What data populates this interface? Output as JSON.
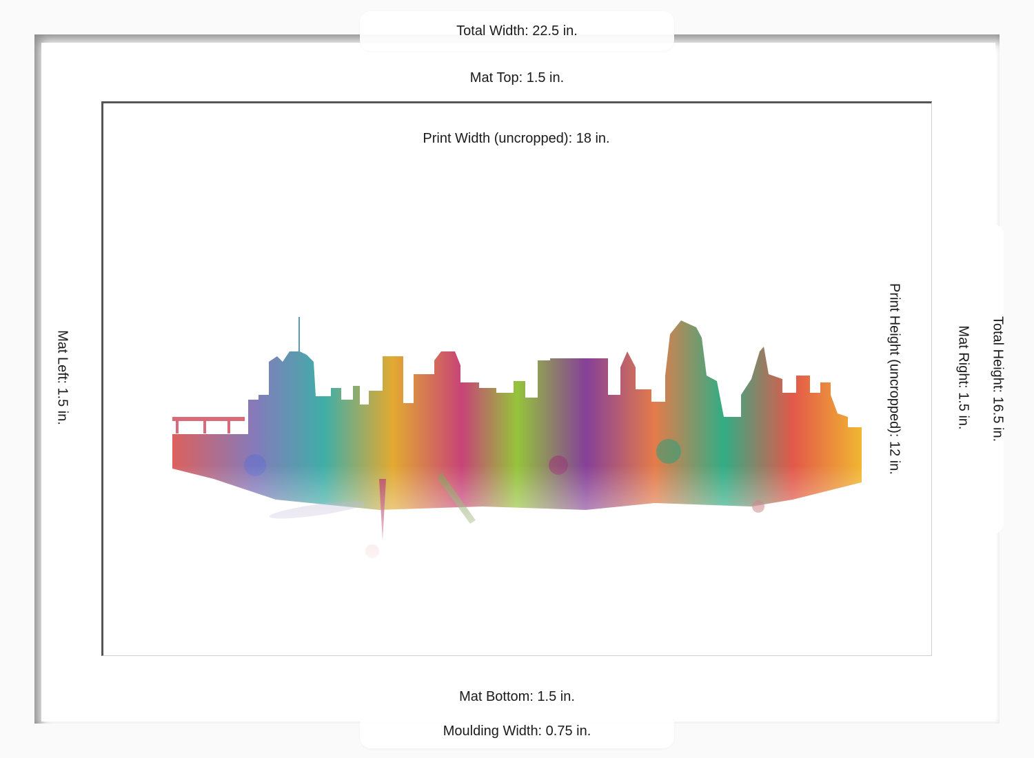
{
  "dimensions": {
    "total_width": "Total Width: 22.5 in.",
    "mat_top": "Mat Top: 1.5 in.",
    "print_width": "Print Width (uncropped): 18 in.",
    "mat_left": "Mat Left: 1.5 in.",
    "print_height": "Print Height (uncropped): 12 in.",
    "mat_right": "Mat Right: 1.5 in.",
    "total_height": "Total Height: 16.5 in.",
    "mat_bottom": "Mat Bottom: 1.5 in.",
    "moulding_width": "Moulding Width: 0.75 in."
  },
  "colors": {
    "moulding": "#ffffff",
    "mat": "#ffffff",
    "window_edge": "#555555"
  }
}
